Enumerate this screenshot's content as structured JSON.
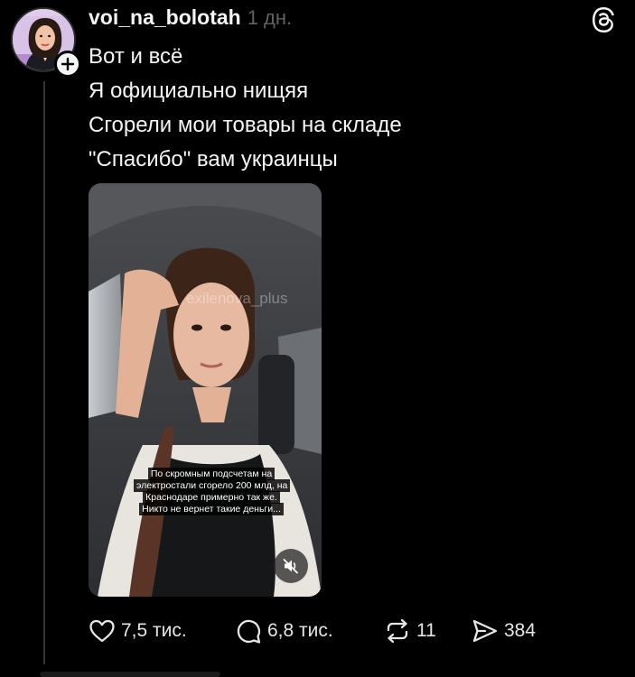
{
  "post": {
    "username": "voi_na_bolotah",
    "timestamp": "1 дн.",
    "lines": [
      "Вот и всё",
      "Я официально нищяя",
      "Сгорели мои товары на складе",
      "\"Спасибо\" вам украинцы"
    ]
  },
  "media": {
    "watermark": "exilenova_plus",
    "caption": "По скромным подсчетам на электростали сгорело 200 млд, на Краснодаре примерно так же. Никто не вернет такие деньги..."
  },
  "actions": {
    "likes": "7,5 тис.",
    "comments": "6,8 тис.",
    "reposts": "11",
    "shares": "384"
  },
  "icons": {
    "like": "heart-icon",
    "comment": "comment-icon",
    "repost": "repost-icon",
    "share": "share-icon",
    "mute": "muted-speaker-icon",
    "app": "threads-logo-icon",
    "follow": "plus-icon"
  },
  "colors": {
    "background": "#000000",
    "text": "#f3f5f7",
    "muted": "#616161",
    "thread_line": "#333638"
  }
}
